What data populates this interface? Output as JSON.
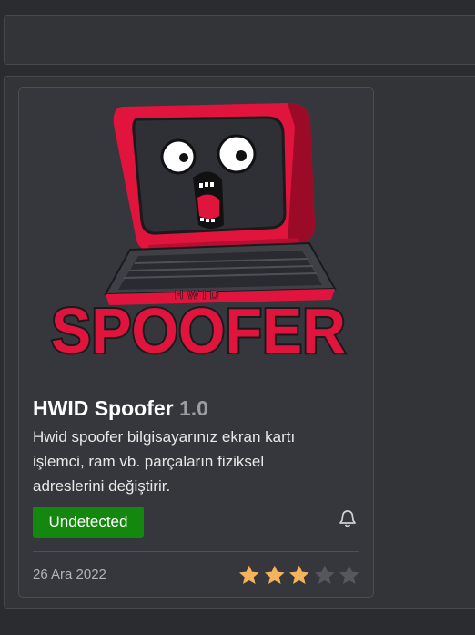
{
  "product": {
    "title": "HWID Spoofer",
    "version": "1.0",
    "description": "Hwid spoofer bilgisayarınız ekran kartı işlemci, ram vb. parçaların fiziksel adreslerini değiştirir.",
    "status": "Undetected",
    "date": "26 Ara 2022",
    "rating": 3,
    "rating_max": 5,
    "logo_text": "SPOOFER",
    "logo_subtext": "HWID"
  },
  "colors": {
    "status_bg": "#14870f",
    "star_filled": "#f5b35b",
    "star_empty": "#55575c",
    "logo_red": "#e0143c"
  },
  "icons": {
    "notify": "bell-icon",
    "rating": "star-icon"
  }
}
